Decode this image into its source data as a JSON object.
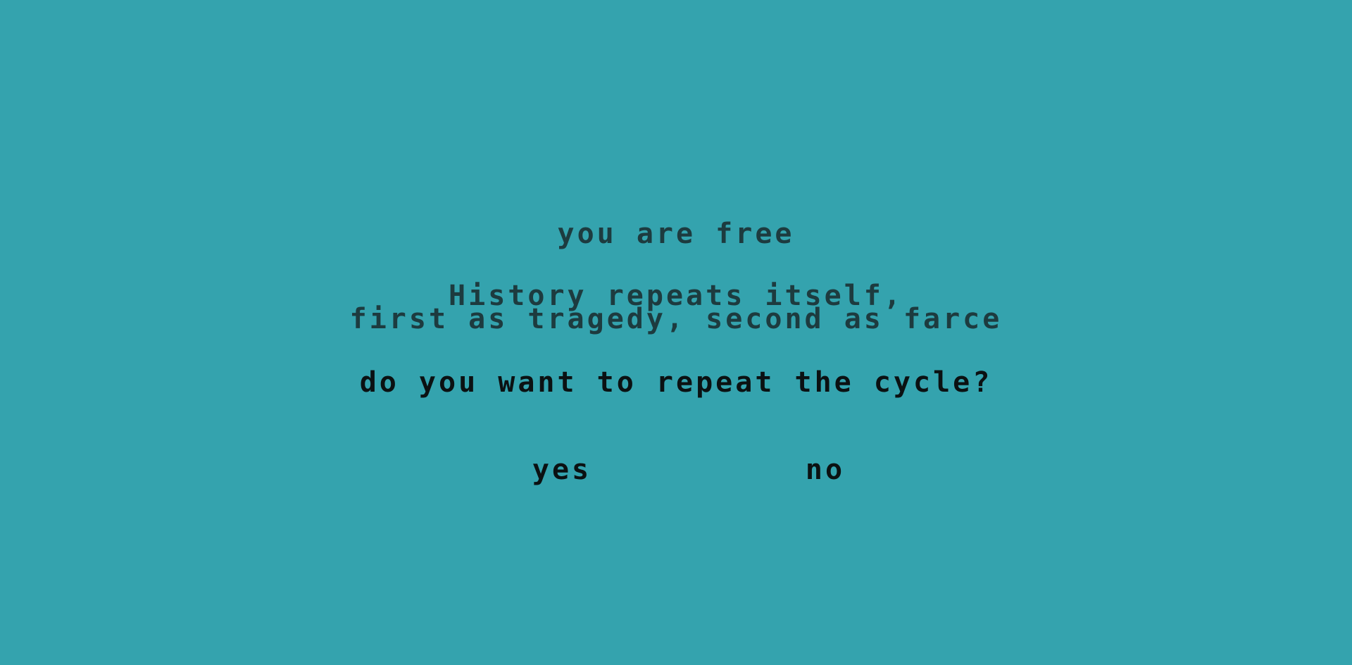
{
  "screen": {
    "background_color": "#34a3ae",
    "text_color_dim": "#1d3b3f",
    "text_color_dark": "#0b1112",
    "status": "you are free",
    "quote": {
      "line1": "History repeats itself,",
      "line2": "first as tragedy, second as farce"
    },
    "prompt": "do you want to repeat the cycle?",
    "choices": {
      "yes": "yes",
      "no": "no"
    }
  }
}
